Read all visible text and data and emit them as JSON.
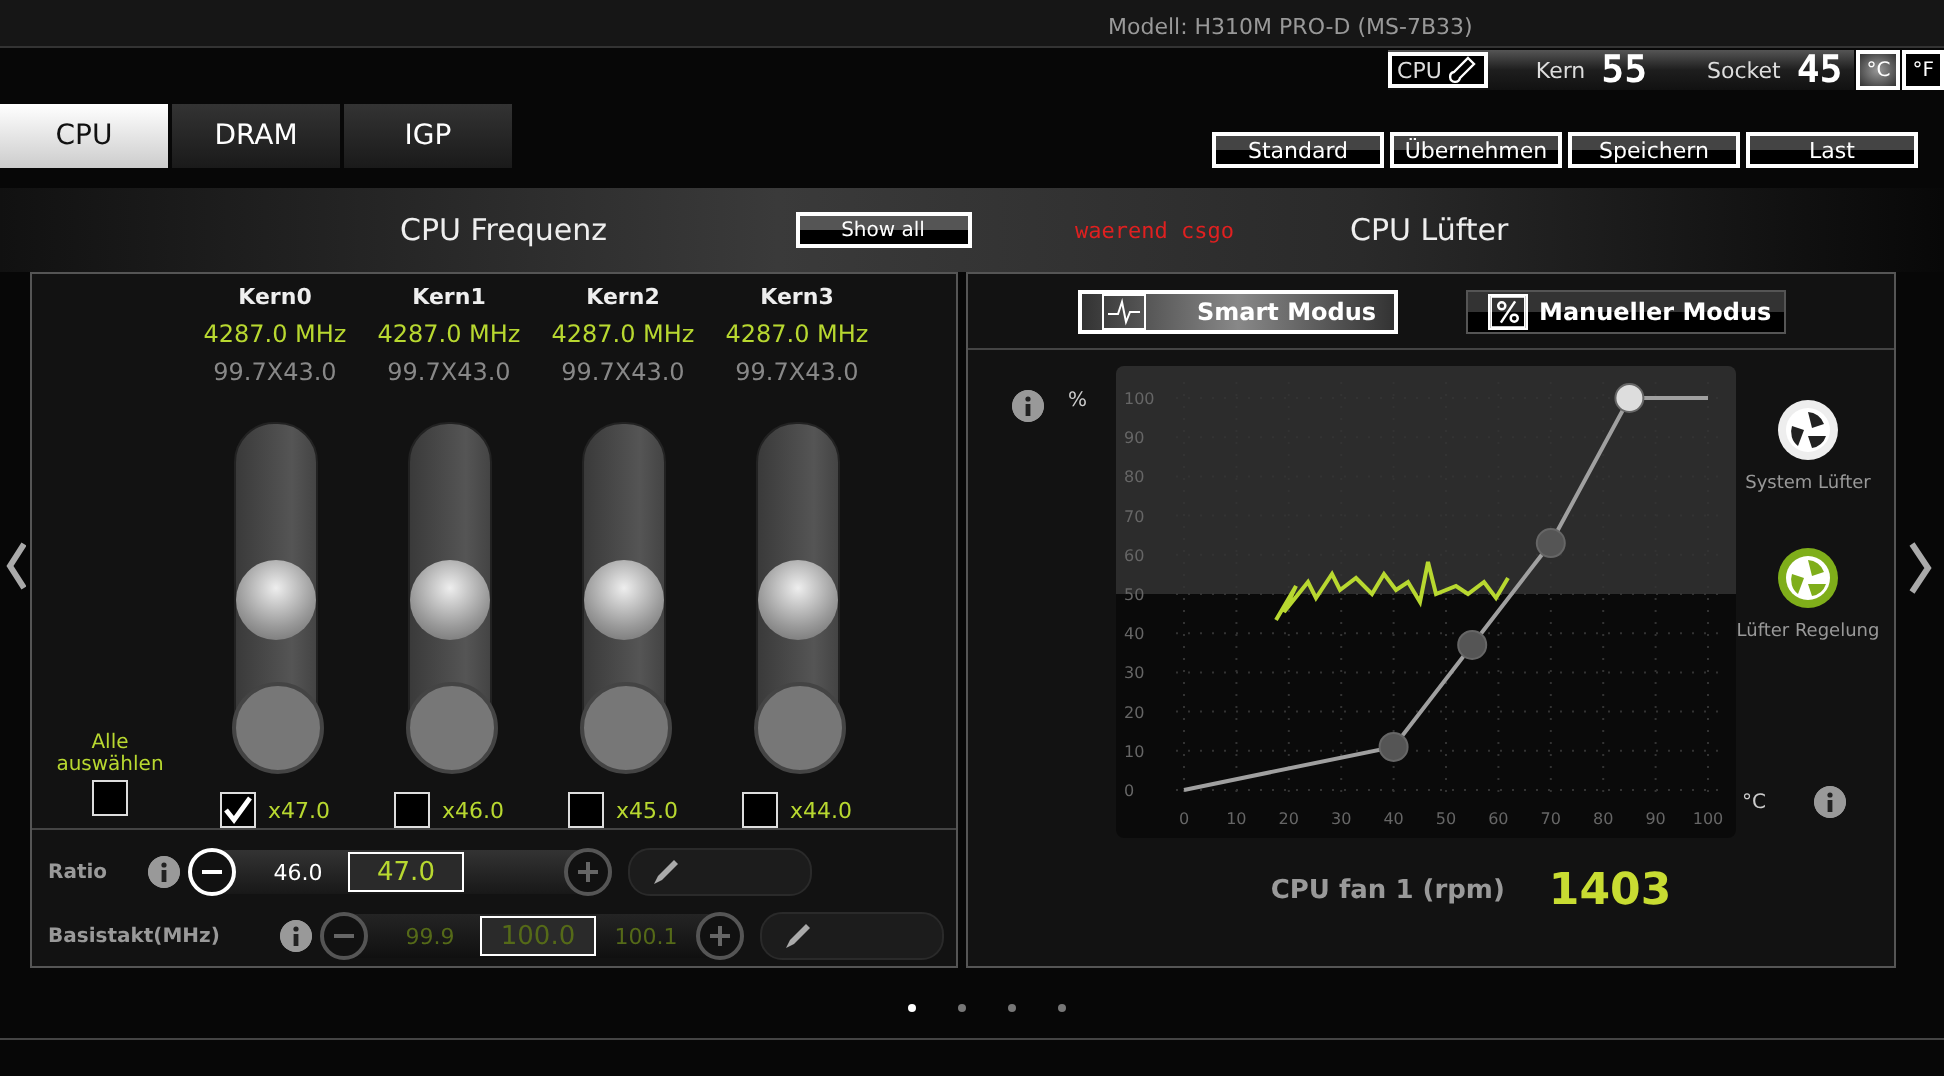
{
  "header": {
    "model": "Modell: H310M PRO-D (MS-7B33)"
  },
  "temperature": {
    "sensor_label": "CPU",
    "core_label": "Kern",
    "core_digits": "55",
    "socket_label": "Socket",
    "socket_digits": "45",
    "units": [
      {
        "label": "°C",
        "selected": true
      },
      {
        "label": "°F",
        "selected": false
      }
    ]
  },
  "tabs": [
    {
      "label": "CPU",
      "selected": true
    },
    {
      "label": "DRAM",
      "selected": false
    },
    {
      "label": "IGP",
      "selected": false
    }
  ],
  "actions": [
    "Standard",
    "Übernehmen",
    "Speichern",
    "Last"
  ],
  "cpu_frequency": {
    "title": "CPU Frequenz",
    "show_all": "Show all",
    "cores": [
      {
        "name": "Kern0",
        "mhz": "4287.0 MHz",
        "ratio_text": "99.7X43.0",
        "level": 0.5,
        "checked": true,
        "multiplier": "x47.0"
      },
      {
        "name": "Kern1",
        "mhz": "4287.0 MHz",
        "ratio_text": "99.7X43.0",
        "level": 0.5,
        "checked": false,
        "multiplier": "x46.0"
      },
      {
        "name": "Kern2",
        "mhz": "4287.0 MHz",
        "ratio_text": "99.7X43.0",
        "level": 0.5,
        "checked": false,
        "multiplier": "x45.0"
      },
      {
        "name": "Kern3",
        "mhz": "4287.0 MHz",
        "ratio_text": "99.7X43.0",
        "level": 0.5,
        "checked": false,
        "multiplier": "x44.0"
      }
    ],
    "select_all": {
      "label": "Alle auswählen",
      "checked": false
    },
    "settings": [
      {
        "label": "Ratio",
        "previous": "46.0",
        "value": "47.0",
        "disabled": false
      },
      {
        "label": "Basistakt(MHz)",
        "previous": "99.9",
        "value": "100.0",
        "next": "100.1",
        "disabled": true
      }
    ]
  },
  "annotation": "waerend csgo",
  "cpu_fan": {
    "title": "CPU Lüfter",
    "modes": [
      {
        "label": "Smart Modus",
        "kind": "wave",
        "selected": true
      },
      {
        "label": "Manueller Modus",
        "kind": "percent",
        "selected": false
      }
    ],
    "y_unit": "%",
    "x_unit": "°C",
    "chart_data": {
      "type": "line",
      "x": [
        0,
        40,
        55,
        70,
        85,
        100
      ],
      "series": [
        {
          "color": "#a0a0a0",
          "values": [
            0,
            11,
            37,
            63,
            100,
            100
          ]
        }
      ],
      "xlim": [
        0,
        100
      ],
      "ylim": [
        0,
        100
      ],
      "grid": true,
      "xticks": [
        0,
        10,
        20,
        30,
        40,
        50,
        60,
        70,
        80,
        90,
        100
      ],
      "yticks": [
        0,
        10,
        20,
        30,
        40,
        50,
        60,
        70,
        80,
        90,
        100
      ]
    },
    "fan_targets": [
      {
        "label": "System Lüfter",
        "selected": false
      },
      {
        "label": "Lüfter Regelung",
        "selected": true
      }
    ],
    "rpm_label": "CPU fan 1 (rpm)",
    "rpm_value": "1403"
  },
  "pages": [
    {
      "selected": true
    },
    {
      "selected": false
    },
    {
      "selected": false
    },
    {
      "selected": false
    }
  ]
}
